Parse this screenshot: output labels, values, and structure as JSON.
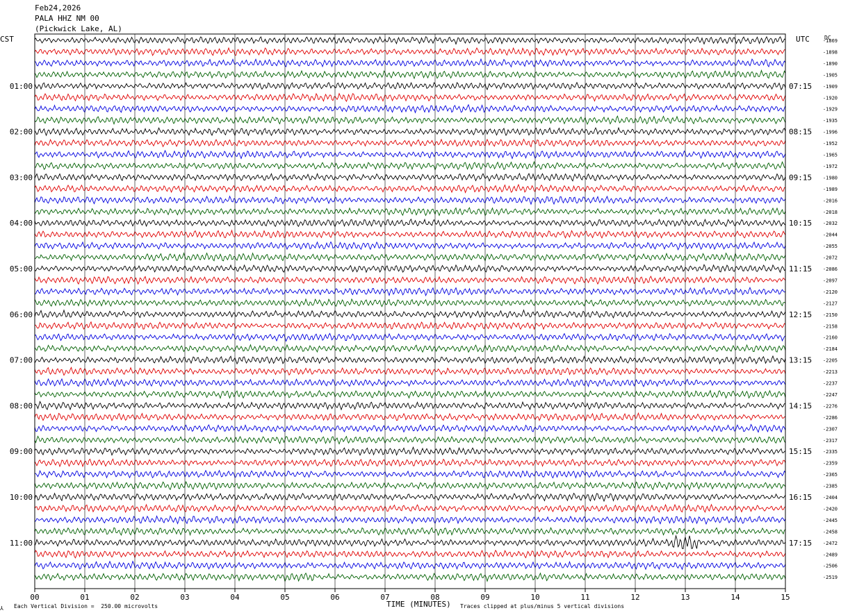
{
  "header": {
    "date": "Feb24,2026",
    "station": "PALA HHZ NM 00",
    "location": "(Pickwick Lake, AL)"
  },
  "left_timezone": "CST",
  "right_timezone": "UTC",
  "right_column_label": "DC",
  "footer": {
    "scale_note": "Each Vertical Division =  250.00 microvolts",
    "clip_note": "Traces clipped at plus/minus 5 vertical divisions",
    "corner_mark": "⅄"
  },
  "colors": {
    "trace": [
      "#000000",
      "#e00000",
      "#0000e0",
      "#006000"
    ],
    "grid": "#000000"
  },
  "chart_data": {
    "type": "line",
    "xlabel": "TIME (MINUTES)",
    "x_ticks": [
      "00",
      "01",
      "02",
      "03",
      "04",
      "05",
      "06",
      "07",
      "08",
      "09",
      "10",
      "11",
      "12",
      "13",
      "14",
      "15"
    ],
    "xlim": [
      0,
      15
    ],
    "trace_count": 48,
    "trace_minutes": 15,
    "left_hour_labels": [
      "01:00",
      "02:00",
      "03:00",
      "04:00",
      "05:00",
      "06:00",
      "07:00",
      "08:00",
      "09:00",
      "10:00",
      "11:00"
    ],
    "right_hour_labels": [
      "07:15",
      "08:15",
      "09:15",
      "10:15",
      "11:15",
      "12:15",
      "13:15",
      "14:15",
      "15:15",
      "16:15",
      "17:15"
    ],
    "dc_offsets": [
      "-1869",
      "-1898",
      "-1890",
      "-1905",
      "-1909",
      "-1920",
      "-1929",
      "-1935",
      "-1996",
      "-1952",
      "-1965",
      "-1972",
      "-1980",
      "-1989",
      "-2016",
      "-2018",
      "-2032",
      "-2044",
      "-2055",
      "-2072",
      "-2086",
      "-2097",
      "-2120",
      "-2127",
      "-2150",
      "-2158",
      "-2160",
      "-2184",
      "-2205",
      "-2213",
      "-2237",
      "-2247",
      "-2276",
      "-2286",
      "-2307",
      "-2317",
      "-2335",
      "-2359",
      "-2365",
      "-2385",
      "-2404",
      "-2420",
      "-2445",
      "-2458",
      "-2472",
      "-2489",
      "-2506",
      "-2519"
    ],
    "events": [
      {
        "trace_index": 44,
        "minute_start": 12.75,
        "minute_end": 13.25,
        "amplitude": "large"
      },
      {
        "trace_index": 47,
        "minute_start": 5.0,
        "minute_end": 5.6,
        "amplitude": "medium"
      }
    ]
  }
}
